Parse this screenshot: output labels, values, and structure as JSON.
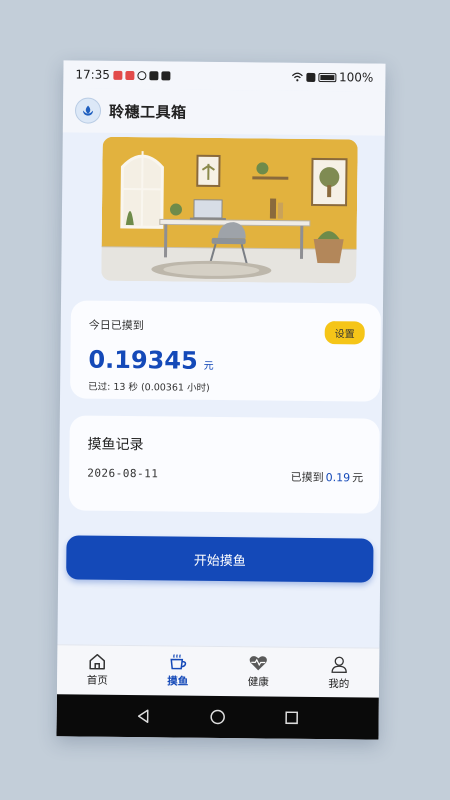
{
  "status": {
    "time": "17:35",
    "battery": "100%"
  },
  "app": {
    "title": "聆穗工具箱",
    "logo_icon": "leaf-logo-icon"
  },
  "today": {
    "label": "今日已摸到",
    "settings_label": "设置",
    "amount": "0.19345",
    "unit": "元",
    "elapsed": "已过: 13 秒 (0.00361 小时)"
  },
  "record": {
    "title": "摸鱼记录",
    "date": "2026-08-11",
    "prefix": "已摸到",
    "amount": "0.19",
    "unit": "元"
  },
  "start_button": "开始摸鱼",
  "tabs": [
    {
      "label": "首页",
      "icon": "home-icon"
    },
    {
      "label": "摸鱼",
      "icon": "coffee-cup-icon"
    },
    {
      "label": "健康",
      "icon": "heart-icon"
    },
    {
      "label": "我的",
      "icon": "user-icon"
    }
  ],
  "colors": {
    "accent": "#1449b8",
    "settings_button": "#f5c518",
    "background": "#eaf0fb"
  }
}
